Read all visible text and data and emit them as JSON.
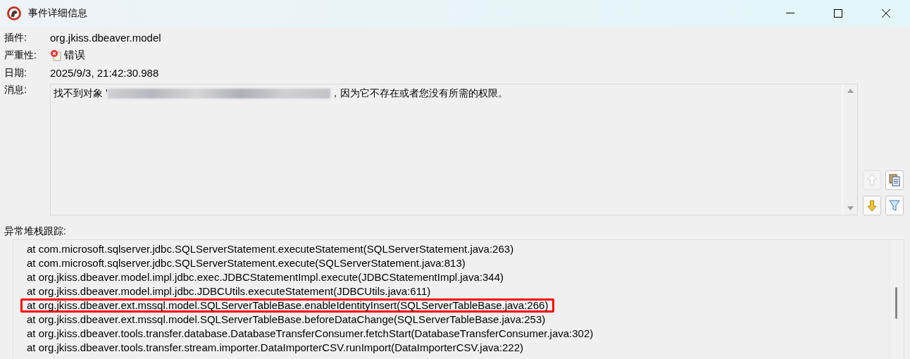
{
  "window": {
    "title": "事件详细信息"
  },
  "fields": [
    {
      "label": "插件:",
      "value": "org.jkiss.dbeaver.model",
      "kind": "text"
    },
    {
      "label": "严重性:",
      "value": "错误",
      "kind": "severity"
    },
    {
      "label": "日期:",
      "value": "2025/9/3, 21:42:30.988",
      "kind": "text"
    }
  ],
  "message": {
    "label": "消息:",
    "before": "找不到对象 '",
    "redacted": true,
    "after": "，因为它不存在或者您没有所需的权限。"
  },
  "side_buttons": [
    {
      "kind": "up",
      "disabled": true
    },
    {
      "kind": "copy",
      "disabled": false
    },
    {
      "kind": "down",
      "disabled": false
    },
    {
      "kind": "filter",
      "disabled": false
    }
  ],
  "stack": {
    "label": "异常堆栈跟踪:",
    "lines": [
      {
        "text": "at com.microsoft.sqlserver.jdbc.SQLServerStatement.executeStatement(SQLServerStatement.java:263)",
        "highlighted": false
      },
      {
        "text": "at com.microsoft.sqlserver.jdbc.SQLServerStatement.execute(SQLServerStatement.java:813)",
        "highlighted": false
      },
      {
        "text": "at org.jkiss.dbeaver.model.impl.jdbc.exec.JDBCStatementImpl.execute(JDBCStatementImpl.java:344)",
        "highlighted": false
      },
      {
        "text": "at org.jkiss.dbeaver.model.impl.jdbc.JDBCUtils.executeStatement(JDBCUtils.java:611)",
        "highlighted": false
      },
      {
        "text": "at org.jkiss.dbeaver.ext.mssql.model.SQLServerTableBase.enableIdentityInsert(SQLServerTableBase.java:266)",
        "highlighted": true
      },
      {
        "text": "at org.jkiss.dbeaver.ext.mssql.model.SQLServerTableBase.beforeDataChange(SQLServerTableBase.java:253)",
        "highlighted": false
      },
      {
        "text": "at org.jkiss.dbeaver.tools.transfer.database.DatabaseTransferConsumer.fetchStart(DatabaseTransferConsumer.java:302)",
        "highlighted": false
      },
      {
        "text": "at org.jkiss.dbeaver.tools.transfer.stream.importer.DataImporterCSV.runImport(DataImporterCSV.java:222)",
        "highlighted": false
      }
    ]
  }
}
